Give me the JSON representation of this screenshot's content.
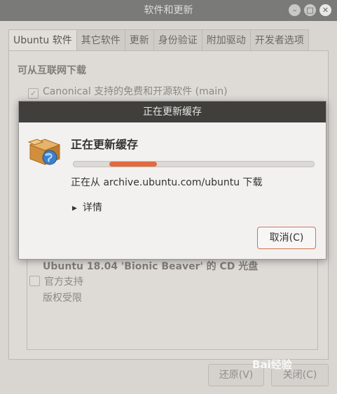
{
  "window": {
    "title": "软件和更新"
  },
  "tabs": [
    {
      "label": "Ubuntu 软件"
    },
    {
      "label": "其它软件"
    },
    {
      "label": "更新"
    },
    {
      "label": "身份验证"
    },
    {
      "label": "附加驱动"
    },
    {
      "label": "开发者选项"
    }
  ],
  "main": {
    "section_title": "可从互联网下载",
    "canonical_checkbox": "Canonical 支持的免费和开源软件 (main)",
    "cd_title": "Ubuntu 18.04 'Bionic Beaver' 的 CD 光盘",
    "cd_official": "官方支持",
    "cd_restricted": "版权受限"
  },
  "bottom": {
    "revert": "还原(V)",
    "close": "关闭(C)"
  },
  "dialog": {
    "title": "正在更新缓存",
    "heading": "正在更新缓存",
    "status": "正在从 archive.ubuntu.com/ubuntu 下载",
    "details": "详情",
    "cancel": "取消(C)",
    "accent_color": "#e06a3e"
  },
  "watermark": "Bai经验"
}
